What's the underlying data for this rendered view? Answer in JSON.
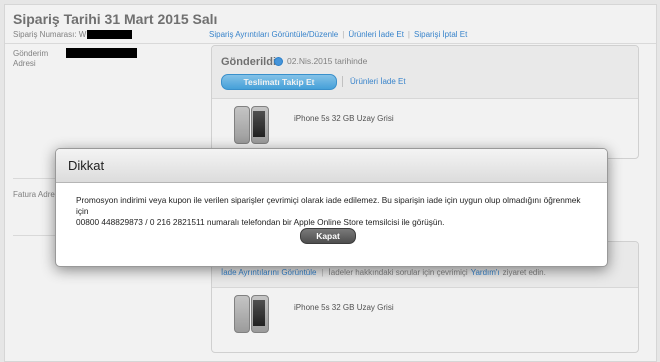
{
  "order": {
    "title": "Sipariş Tarihi 31 Mart 2015 Salı",
    "number_label": "Sipariş Numarası: W",
    "links": [
      "Sipariş Ayrıntıları Görüntüle/Düzenle",
      "Ürünleri İade Et",
      "Siparişi İptal Et"
    ]
  },
  "shipping": {
    "label_line1": "Gönderim",
    "label_line2": "Adresi"
  },
  "billing": {
    "label": "Fatura Adre"
  },
  "shipment": {
    "status": "Gönderildi",
    "date": "02.Nis.2015 tarihinde",
    "track_button": "Teslimatı Takip Et",
    "return_link": "Ürünleri İade Et",
    "product_name": "iPhone 5s 32 GB Uzay Grisi"
  },
  "shipment2": {
    "return_details_link": "İade Ayrıntılarını Görüntüle",
    "help_prefix": "İadeler hakkındaki sorular için çevrimiçi",
    "help_link": "Yardım'ı",
    "help_suffix": "ziyaret edin.",
    "product_name": "iPhone 5s 32 GB Uzay Grisi"
  },
  "dialog": {
    "title": "Dikkat",
    "message_line1": "Promosyon indirimi veya kupon ile verilen siparişler çevrimiçi olarak iade edilemez. Bu siparişin iade için uygun olup olmadığını öğrenmek için",
    "message_line2": "00800 448829873 / 0 216 2821511 numaralı telefondan bir Apple Online Store temsilcisi ile görüşün.",
    "close_button": "Kapat"
  },
  "colors": {
    "link": "#3b8bd6",
    "accent_button": "#4aa9e4",
    "dialog_button": "#555555"
  }
}
